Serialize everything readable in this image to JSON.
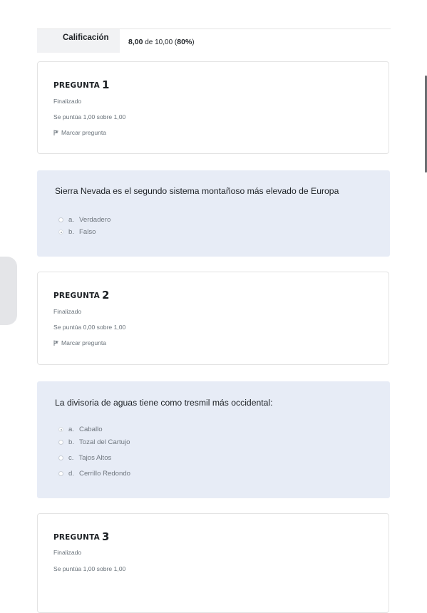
{
  "grade": {
    "label": "Calificación",
    "score": "8,00",
    "max_text": "de 10,00 (",
    "percent": "80%",
    "close": ")"
  },
  "questions": [
    {
      "title_label": "PREGUNTA",
      "number": "1",
      "state": "Finalizado",
      "score_text": "Se puntúa 1,00 sobre 1,00",
      "flag_label": "Marcar pregunta",
      "text": "Sierra Nevada es el segundo sistema montañoso más elevado de Europa",
      "options": [
        {
          "letter": "a.",
          "label": "Verdadero",
          "selected": false
        },
        {
          "letter": "b.",
          "label": "Falso",
          "selected": true
        }
      ]
    },
    {
      "title_label": "PREGUNTA",
      "number": "2",
      "state": "Finalizado",
      "score_text": "Se puntúa 0,00 sobre 1,00",
      "flag_label": "Marcar pregunta",
      "text": "La divisoria de aguas tiene como tresmil más occidental:",
      "options": [
        {
          "letter": "a.",
          "label": "Caballo",
          "selected": true
        },
        {
          "letter": "b.",
          "label": "Tozal del Cartujo",
          "selected": false
        },
        {
          "letter": "c.",
          "label": "Tajos Altos",
          "selected": false
        },
        {
          "letter": "d.",
          "label": "Cerrillo Redondo",
          "selected": false
        }
      ]
    },
    {
      "title_label": "PREGUNTA",
      "number": "3",
      "state": "Finalizado",
      "score_text": "Se puntúa 1,00 sobre 1,00"
    }
  ],
  "icons": {
    "flag": "flag-icon",
    "drawer_toggle": "chevron-right-icon"
  }
}
